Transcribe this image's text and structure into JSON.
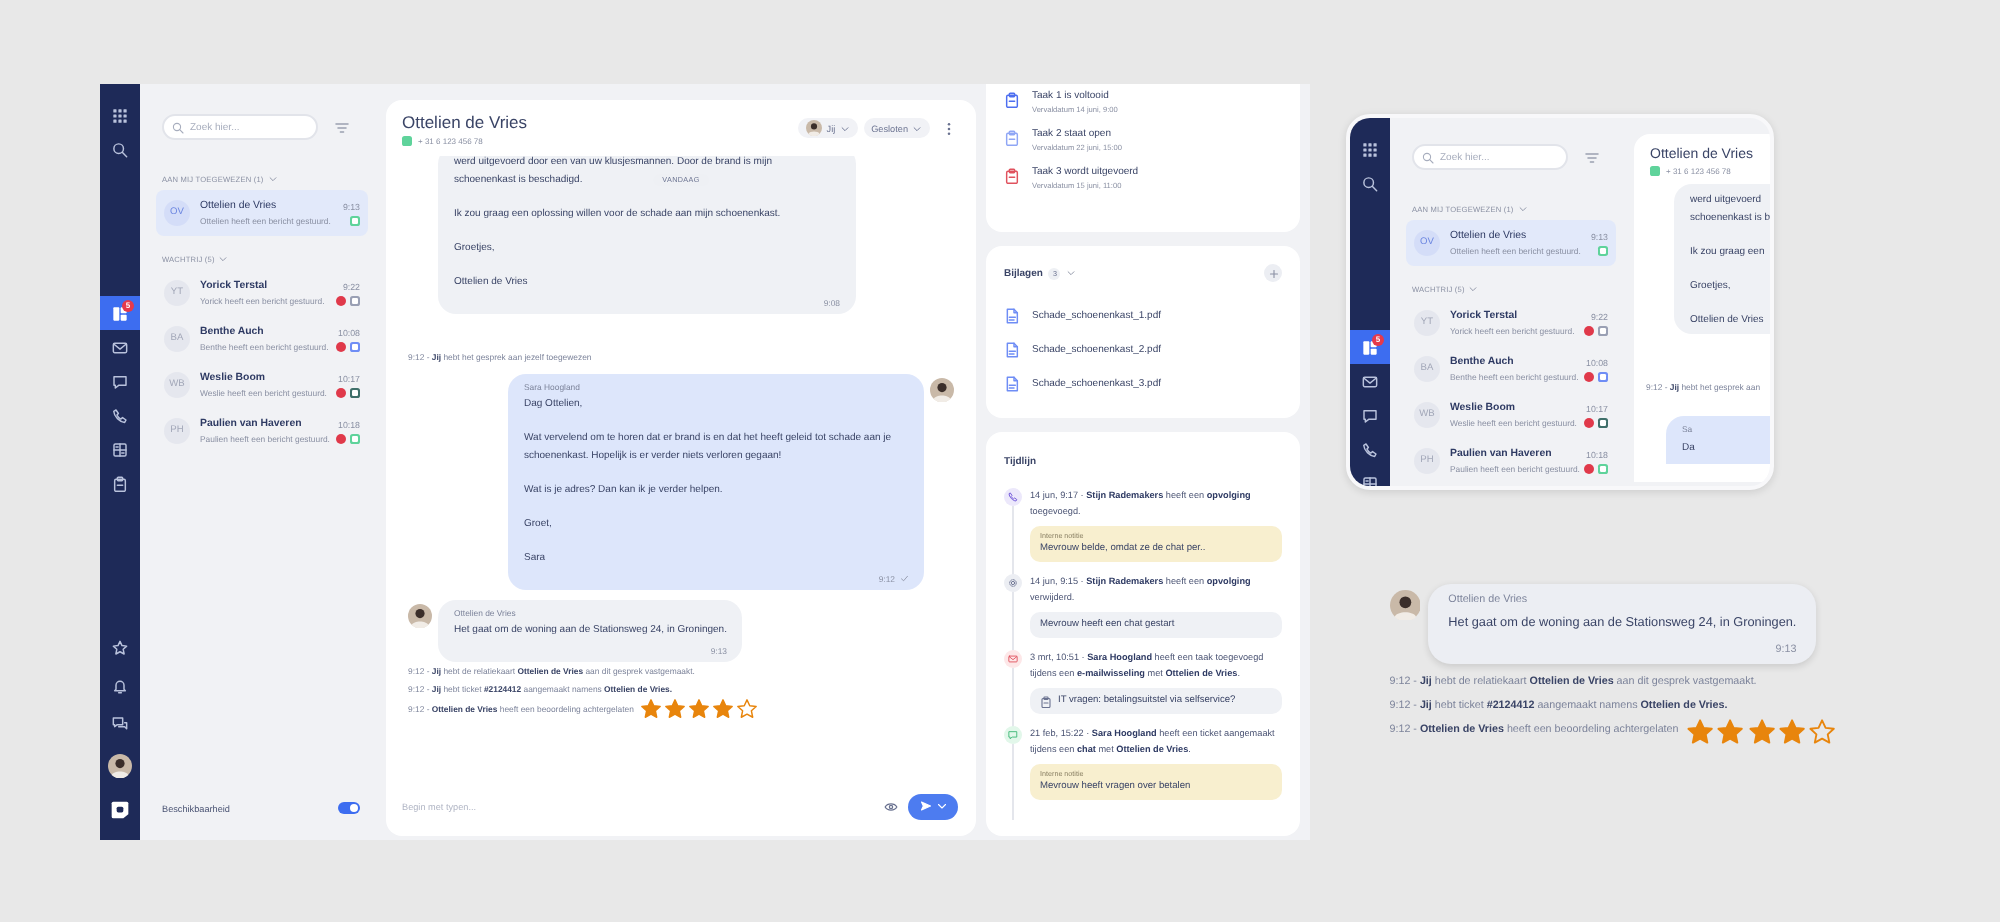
{
  "app": {
    "nav": {
      "items": [
        {
          "selected": true,
          "badge": "5"
        },
        {
          "selected": false
        },
        {
          "selected": false
        },
        {
          "selected": false
        },
        {
          "selected": false
        },
        {
          "selected": false
        }
      ]
    },
    "search": {
      "placeholder": "Zoek hier..."
    },
    "sections": [
      {
        "title": "AAN MIJ TOEGEWEZEN (1)",
        "conversations": [
          {
            "initials": "OV",
            "name": "Ottelien de Vries",
            "preview": "Ottelien heeft een bericht gestuurd.",
            "time": "9:13",
            "selected": true,
            "unread": false,
            "color": "#5fd39b"
          }
        ]
      },
      {
        "title": "WACHTRIJ (5)",
        "conversations": [
          {
            "initials": "YT",
            "name": "Yorick Terstal",
            "preview": "Yorick heeft een bericht gestuurd.",
            "time": "9:22",
            "selected": false,
            "unread": true,
            "color": "#9aa0b4"
          },
          {
            "initials": "BA",
            "name": "Benthe Auch",
            "preview": "Benthe heeft een bericht gestuurd.",
            "time": "10:08",
            "selected": false,
            "unread": true,
            "color": "#6f8df5"
          },
          {
            "initials": "WB",
            "name": "Weslie Boom",
            "preview": "Weslie heeft een bericht gestuurd.",
            "time": "10:17",
            "selected": false,
            "unread": true,
            "color": "#3f6f6a"
          },
          {
            "initials": "PH",
            "name": "Paulien van Haveren",
            "preview": "Paulien heeft een bericht gestuurd.",
            "time": "10:18",
            "selected": false,
            "unread": true,
            "color": "#5fd39b"
          }
        ]
      }
    ],
    "availability": {
      "label": "Beschikbaarheid",
      "on": true
    },
    "chat": {
      "title": "Ottelien de Vries",
      "phone": "+ 31 6 123 456 78",
      "assignee": "Jij",
      "status": "Gesloten",
      "date_pill": "VANDAAG",
      "messages": [
        {
          "kind": "incoming",
          "avatar": false,
          "paragraphs": [
            [
              "werd uitgevoerd door een van uw klusjesmannen. Door de brand is mijn",
              "schoenenkast is beschadigd."
            ],
            [
              "Ik zou graag een oplossing willen voor de schade aan mijn schoenenkast."
            ],
            [
              "Groetjes,"
            ],
            [
              "Ottelien de Vries"
            ]
          ],
          "time": "9:08"
        },
        {
          "kind": "system",
          "text": "9:12 - **Jij** hebt het gesprek aan jezelf toegewezen"
        },
        {
          "kind": "outgoing",
          "sender": "Sara Hoogland",
          "paragraphs": [
            [
              "Dag Ottelien,"
            ],
            [
              "Wat vervelend om te horen dat er brand is en dat het heeft geleid tot schade aan je",
              "schoenenkast. Hopelijk is er verder niets verloren gegaan!"
            ],
            [
              "Wat is je adres? Dan kan ik je verder helpen."
            ],
            [
              "Groet,"
            ],
            [
              "Sara"
            ]
          ],
          "time": "9:12",
          "read": true
        },
        {
          "kind": "incoming",
          "avatar": true,
          "sender": "Ottelien de Vries",
          "paragraphs": [
            [
              "Het gaat om de woning aan de Stationsweg 24, in Groningen."
            ]
          ],
          "time": "9:13"
        },
        {
          "kind": "system",
          "text": "9:12 - **Jij** hebt de relatiekaart **Ottelien de Vries** aan dit gesprek vastgemaakt."
        },
        {
          "kind": "system",
          "text": "9:12 - **Jij** hebt ticket **#2124412** aangemaakt namens **Ottelien de Vries.**"
        },
        {
          "kind": "system",
          "text": "9:12 - **Ottelien de Vries** heeft een beoordeling achtergelaten",
          "stars": 4
        }
      ],
      "input": {
        "placeholder": "Begin met typen..."
      }
    },
    "tasks": [
      {
        "title": "Taak 1 is voltooid",
        "due": "Vervaldatum 14 juni, 9:00",
        "color": "#4d6ef0"
      },
      {
        "title": "Taak 2 staat open",
        "due": "Vervaldatum 22 juni, 15:00",
        "color": "#8fa6f5"
      },
      {
        "title": "Taak 3 wordt uitgevoerd",
        "due": "Vervaldatum 15 juni, 11:00",
        "color": "#e0525e"
      }
    ],
    "attachments": {
      "title": "Bijlagen",
      "count": "3",
      "files": [
        "Schade_schoenenkast_1.pdf",
        "Schade_schoenenkast_2.pdf",
        "Schade_schoenenkast_3.pdf"
      ]
    },
    "timeline": {
      "title": "Tijdlijn",
      "events": [
        {
          "kind": "phone",
          "text": "14 jun, 9:17 · **Stijn Rademakers** heeft een **opvolging** toegevoegd.",
          "note": {
            "kind": "internal",
            "label": "Interne notitie",
            "text": "Mevrouw belde, omdat ze de chat per.."
          }
        },
        {
          "kind": "gear",
          "text": "14 jun, 9:15 · **Stijn Rademakers** heeft een **opvolging** verwijderd.",
          "note": {
            "kind": "plain",
            "text": "Mevrouw heeft een chat gestart"
          }
        },
        {
          "kind": "mail",
          "text": "3 mrt, 10:51 · **Sara Hoogland** heeft een taak toegevoegd tijdens een **e-mailwisseling** met **Ottelien de Vries**.",
          "note": {
            "kind": "task",
            "text": "IT vragen: betalingsuitstel via selfservice?"
          }
        },
        {
          "kind": "chat",
          "text": "21 feb, 15:22 · **Sara Hoogland** heeft een ticket aangemaakt tijdens een **chat** met **Ottelien de Vries**.",
          "note": {
            "kind": "internal",
            "label": "Interne notitie",
            "text": "Mevrouw heeft vragen over betalen"
          }
        }
      ]
    }
  },
  "mobile": {
    "nav": {
      "items": [
        {
          "selected": true,
          "badge": "5"
        },
        {
          "selected": false
        },
        {
          "selected": false
        },
        {
          "selected": false
        },
        {
          "selected": false
        }
      ]
    },
    "search": {
      "placeholder": "Zoek hier..."
    },
    "sections": [
      {
        "title": "AAN MIJ TOEGEWEZEN (1)",
        "conversations": [
          {
            "initials": "OV",
            "name": "Ottelien de Vries",
            "preview": "Ottelien heeft een bericht gestuurd.",
            "time": "9:13",
            "selected": true,
            "unread": false,
            "color": "#5fd39b"
          }
        ]
      },
      {
        "title": "WACHTRIJ (5)",
        "conversations": [
          {
            "initials": "YT",
            "name": "Yorick Terstal",
            "preview": "Yorick heeft een bericht gestuurd.",
            "time": "9:22",
            "selected": false,
            "unread": true,
            "color": "#9aa0b4"
          },
          {
            "initials": "BA",
            "name": "Benthe Auch",
            "preview": "Benthe heeft een bericht gestuurd.",
            "time": "10:08",
            "selected": false,
            "unread": true,
            "color": "#6f8df5"
          },
          {
            "initials": "WB",
            "name": "Weslie Boom",
            "preview": "Weslie heeft een bericht gestuurd.",
            "time": "10:17",
            "selected": false,
            "unread": true,
            "color": "#3f6f6a"
          },
          {
            "initials": "PH",
            "name": "Paulien van Haveren",
            "preview": "Paulien heeft een bericht gestuurd.",
            "time": "10:18",
            "selected": false,
            "unread": true,
            "color": "#5fd39b"
          }
        ]
      }
    ],
    "chat": {
      "title": "Ottelien de Vries",
      "phone": "+ 31 6 123 456 78",
      "paragraphs": [
        [
          "werd uitgevoerd",
          "schoenenkast is b"
        ],
        [
          "Ik zou graag een"
        ],
        [
          "Groetjes,"
        ],
        [
          "Ottelien de Vries"
        ]
      ],
      "system": "9:12 - **Jij** hebt het gesprek aan",
      "sender": "Sa",
      "first_line": "Da"
    }
  },
  "detail": {
    "messages": [
      {
        "kind": "incoming",
        "avatar": true,
        "sender": "Ottelien de Vries",
        "paragraphs": [
          [
            "Het gaat om de woning aan de Stationsweg 24, in Groningen."
          ]
        ],
        "time": "9:13"
      },
      {
        "kind": "system",
        "text": "9:12 - **Jij** hebt de relatiekaart **Ottelien de Vries** aan dit gesprek vastgemaakt."
      },
      {
        "kind": "system",
        "text": "9:12 - **Jij** hebt ticket **#2124412** aangemaakt namens **Ottelien de Vries.**"
      },
      {
        "kind": "system",
        "text": "9:12 - **Ottelien de Vries** heeft een beoordeling achtergelaten",
        "stars": 4
      }
    ]
  }
}
